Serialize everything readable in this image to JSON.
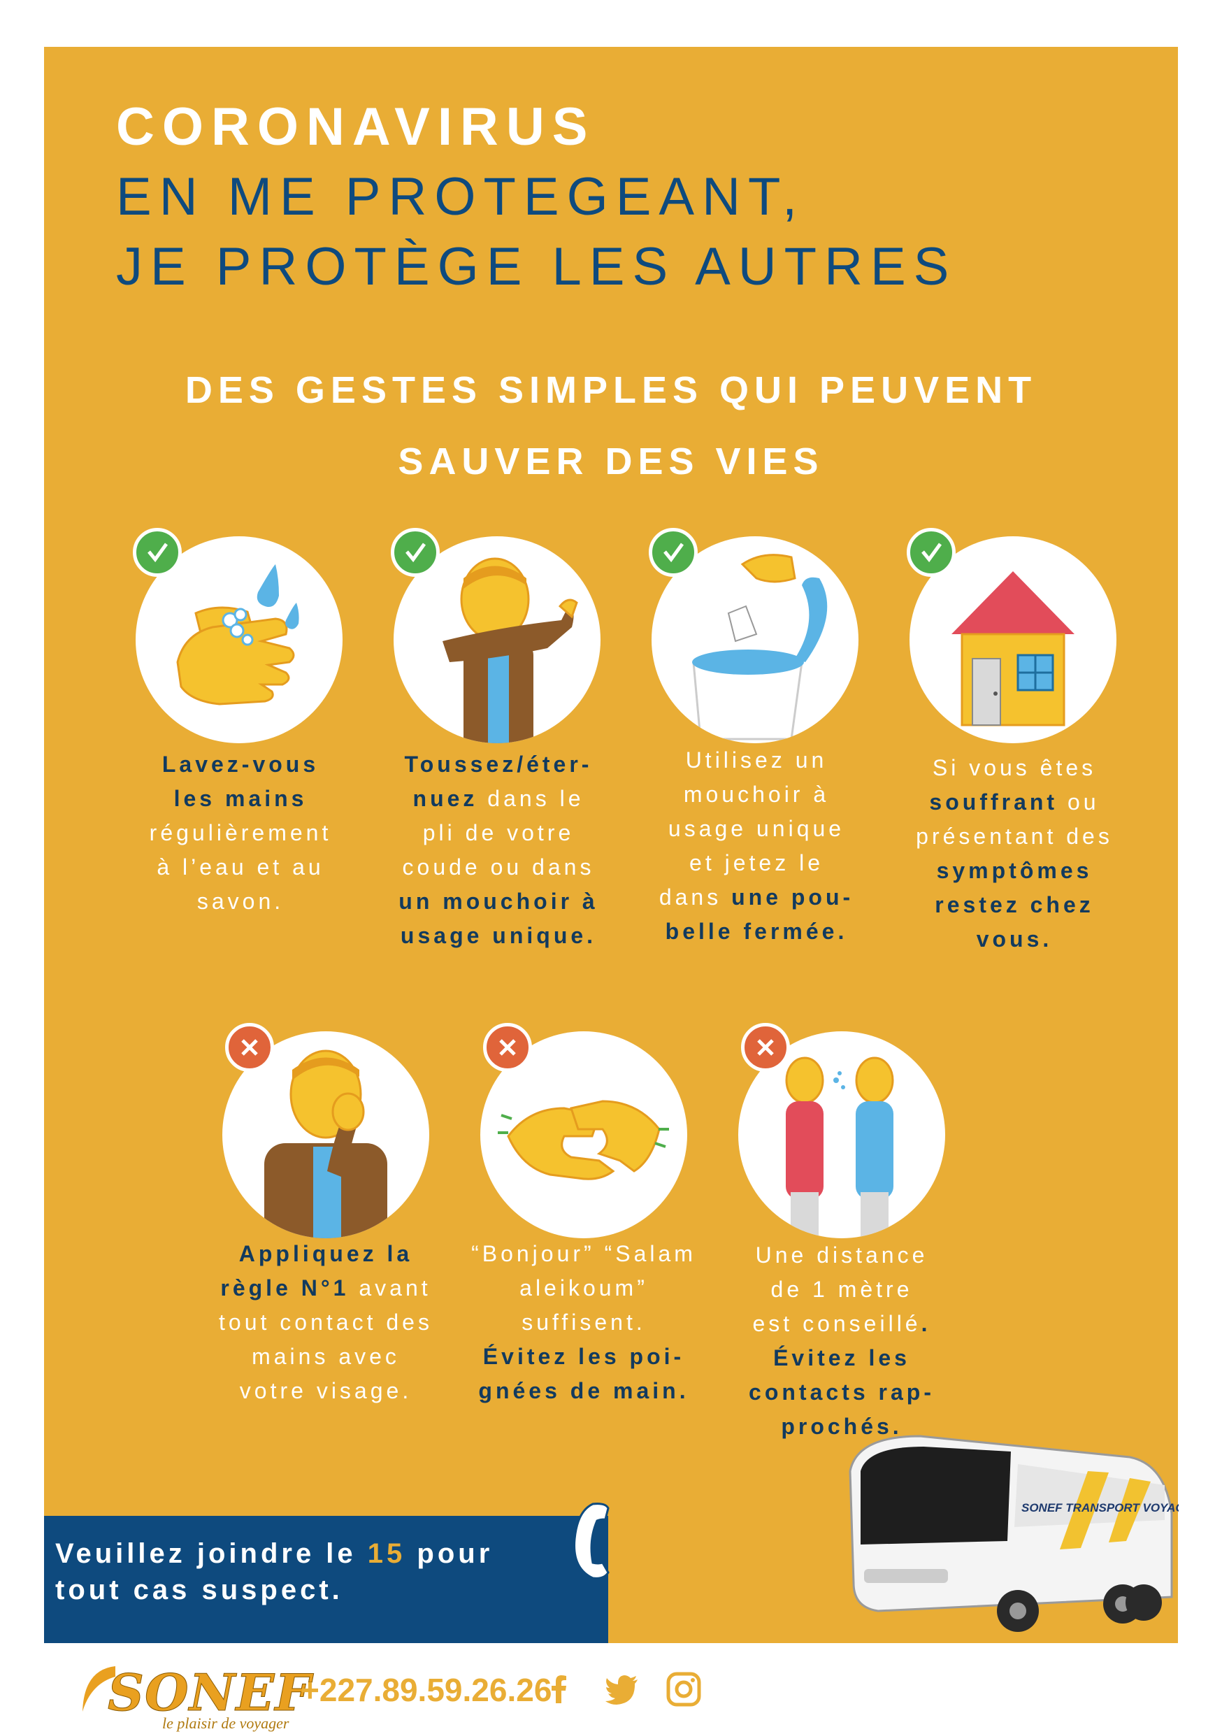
{
  "title": {
    "line1": "CORONAVIRUS",
    "line2": "EN ME PROTEGEANT,",
    "line3": "JE PROTÈGE LES AUTRES"
  },
  "subtitle": {
    "line1": "DES GESTES SIMPLES QUI PEUVENT",
    "line2": "SAUVER DES VIES"
  },
  "colors": {
    "background": "#E9AD35",
    "navy": "#0E4A7E",
    "check_green": "#4FAE4B",
    "cross_red": "#E0643A"
  },
  "dos": [
    {
      "icon": "hand-washing-icon",
      "c": [
        "Lavez-vous",
        "les mains",
        "régulièrement",
        "à l’eau et au",
        "savon."
      ]
    },
    {
      "icon": "elbow-sneeze-icon",
      "c": [
        "Toussez/éter-",
        "nuez",
        " dans le",
        "pli de votre",
        "coude ou dans",
        "un mouchoir à",
        "usage unique."
      ]
    },
    {
      "icon": "tissue-bin-icon",
      "c": [
        "Utilisez un",
        "mouchoir à",
        "usage unique",
        "et jetez le",
        "dans ",
        "une pou-",
        "belle fermée."
      ]
    },
    {
      "icon": "house-icon",
      "c": [
        "Si vous êtes",
        "souffrant",
        " ou",
        "présentant des",
        "symptômes",
        "restez chez",
        "vous."
      ]
    }
  ],
  "donts": [
    {
      "icon": "face-touch-icon",
      "c": [
        "Appliquez la",
        "règle N°1",
        " avant",
        "tout contact des",
        "mains avec",
        "votre visage."
      ]
    },
    {
      "icon": "handshake-icon",
      "c": [
        "“Bonjour” “Salam",
        "aleikoum”",
        "suffisent.",
        "Évitez les poi-",
        "gnées de main."
      ]
    },
    {
      "icon": "distance-icon",
      "c": [
        "Une distance",
        "de 1 mètre",
        "est conseillé",
        ".",
        "Évitez les",
        "contacts rap-",
        "prochés."
      ]
    }
  ],
  "callout": {
    "pre": "Veuillez joindre le ",
    "num": "15",
    "post": " pour",
    "line2": "tout cas suspect."
  },
  "footer": {
    "logo": "SONEF",
    "tagline": "le plaisir de voyager",
    "phone": "+227.89.59.26.26"
  },
  "bus_label": "SONEF TRANSPORT VOYAGEURS"
}
